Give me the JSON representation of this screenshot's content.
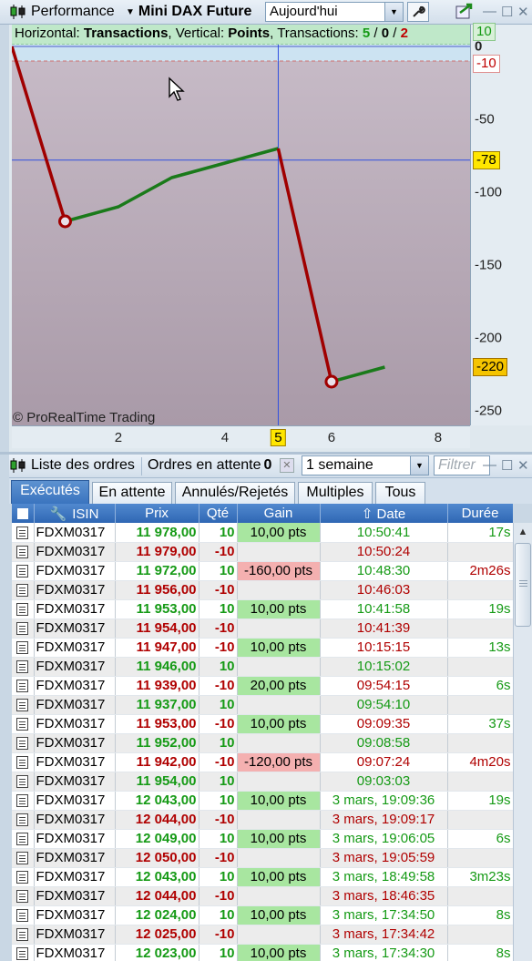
{
  "toolbar": {
    "performance_label": "Performance",
    "instrument_label": "Mini DAX Future",
    "period_value": "Aujourd'hui",
    "icons": [
      "candlestick-icon",
      "chevron-down-icon",
      "wrench-icon",
      "export-icon",
      "minimize-icon",
      "maximize-icon",
      "close-icon"
    ]
  },
  "chart": {
    "info_horizontal_label": "Horizontal:",
    "info_horizontal_value": "Transactions",
    "info_vertical_label": ", Vertical:",
    "info_vertical_value": "Points",
    "info_transactions_label": ", Transactions:",
    "info_wins": "5",
    "info_sep1": " / ",
    "info_even": "0",
    "info_sep2": " / ",
    "info_losses": "2",
    "copyright": "© ProRealTime Trading",
    "tag_up": "10",
    "tag_down": "-10",
    "tag_crosshair": "-78",
    "tag_last": "-220",
    "tag_x": "5",
    "zero_label": "0",
    "colors": {
      "gain": "#1a7a1a",
      "loss": "#a00000",
      "crosshair": "#3050e0",
      "tag_yellow": "#ffe600"
    }
  },
  "chart_data": {
    "type": "line",
    "xlabel": "",
    "ylabel": "",
    "x": [
      0,
      1,
      2,
      3,
      4,
      5,
      6,
      7
    ],
    "y": [
      0,
      -120,
      -110,
      -90,
      -80,
      -70,
      -230,
      -220
    ],
    "segments": [
      {
        "from": 0,
        "to": 1,
        "result": "loss"
      },
      {
        "from": 1,
        "to": 5,
        "result": "gain"
      },
      {
        "from": 5,
        "to": 6,
        "result": "loss"
      },
      {
        "from": 6,
        "to": 7,
        "result": "gain"
      }
    ],
    "loss_markers_x": [
      1,
      6
    ],
    "xticks": [
      2,
      4,
      6,
      8
    ],
    "yticks": [
      -50,
      -100,
      -150,
      -200,
      -250
    ],
    "xlim": [
      0,
      8.6
    ],
    "ylim": [
      -260,
      15
    ],
    "crosshair": {
      "x": 5,
      "y": -78
    },
    "band_lines": [
      10,
      -10
    ]
  },
  "orders": {
    "title": "Liste des ordres",
    "pending_label": "Ordres en attente",
    "pending_count": "0",
    "period_value": "1 semaine",
    "filter_placeholder": "Filtrer",
    "tabs": [
      "Exécutés",
      "En attente",
      "Annulés/Rejetés",
      "Multiples",
      "Tous"
    ],
    "columns": [
      "ISIN",
      "Prix",
      "Qté",
      "Gain",
      "Date",
      "Durée"
    ],
    "rows": [
      {
        "isin": "FDXM0317",
        "prix": "11 978,00",
        "qte": "10",
        "gain": "10,00 pts",
        "date": "10:50:41",
        "duree": "17s"
      },
      {
        "isin": "FDXM0317",
        "prix": "11 979,00",
        "qte": "-10",
        "gain": "",
        "date": "10:50:24",
        "duree": ""
      },
      {
        "isin": "FDXM0317",
        "prix": "11 972,00",
        "qte": "10",
        "gain": "-160,00 pts",
        "date": "10:48:30",
        "duree": "2m26s"
      },
      {
        "isin": "FDXM0317",
        "prix": "11 956,00",
        "qte": "-10",
        "gain": "",
        "date": "10:46:03",
        "duree": ""
      },
      {
        "isin": "FDXM0317",
        "prix": "11 953,00",
        "qte": "10",
        "gain": "10,00 pts",
        "date": "10:41:58",
        "duree": "19s"
      },
      {
        "isin": "FDXM0317",
        "prix": "11 954,00",
        "qte": "-10",
        "gain": "",
        "date": "10:41:39",
        "duree": ""
      },
      {
        "isin": "FDXM0317",
        "prix": "11 947,00",
        "qte": "-10",
        "gain": "10,00 pts",
        "date": "10:15:15",
        "duree": "13s"
      },
      {
        "isin": "FDXM0317",
        "prix": "11 946,00",
        "qte": "10",
        "gain": "",
        "date": "10:15:02",
        "duree": ""
      },
      {
        "isin": "FDXM0317",
        "prix": "11 939,00",
        "qte": "-10",
        "gain": "20,00 pts",
        "date": "09:54:15",
        "duree": "6s"
      },
      {
        "isin": "FDXM0317",
        "prix": "11 937,00",
        "qte": "10",
        "gain": "",
        "date": "09:54:10",
        "duree": ""
      },
      {
        "isin": "FDXM0317",
        "prix": "11 953,00",
        "qte": "-10",
        "gain": "10,00 pts",
        "date": "09:09:35",
        "duree": "37s"
      },
      {
        "isin": "FDXM0317",
        "prix": "11 952,00",
        "qte": "10",
        "gain": "",
        "date": "09:08:58",
        "duree": ""
      },
      {
        "isin": "FDXM0317",
        "prix": "11 942,00",
        "qte": "-10",
        "gain": "-120,00 pts",
        "date": "09:07:24",
        "duree": "4m20s"
      },
      {
        "isin": "FDXM0317",
        "prix": "11 954,00",
        "qte": "10",
        "gain": "",
        "date": "09:03:03",
        "duree": ""
      },
      {
        "isin": "FDXM0317",
        "prix": "12 043,00",
        "qte": "10",
        "gain": "10,00 pts",
        "date": "3 mars, 19:09:36",
        "duree": "19s"
      },
      {
        "isin": "FDXM0317",
        "prix": "12 044,00",
        "qte": "-10",
        "gain": "",
        "date": "3 mars, 19:09:17",
        "duree": ""
      },
      {
        "isin": "FDXM0317",
        "prix": "12 049,00",
        "qte": "10",
        "gain": "10,00 pts",
        "date": "3 mars, 19:06:05",
        "duree": "6s"
      },
      {
        "isin": "FDXM0317",
        "prix": "12 050,00",
        "qte": "-10",
        "gain": "",
        "date": "3 mars, 19:05:59",
        "duree": ""
      },
      {
        "isin": "FDXM0317",
        "prix": "12 043,00",
        "qte": "10",
        "gain": "10,00 pts",
        "date": "3 mars, 18:49:58",
        "duree": "3m23s"
      },
      {
        "isin": "FDXM0317",
        "prix": "12 044,00",
        "qte": "-10",
        "gain": "",
        "date": "3 mars, 18:46:35",
        "duree": ""
      },
      {
        "isin": "FDXM0317",
        "prix": "12 024,00",
        "qte": "10",
        "gain": "10,00 pts",
        "date": "3 mars, 17:34:50",
        "duree": "8s"
      },
      {
        "isin": "FDXM0317",
        "prix": "12 025,00",
        "qte": "-10",
        "gain": "",
        "date": "3 mars, 17:34:42",
        "duree": ""
      },
      {
        "isin": "FDXM0317",
        "prix": "12 023,00",
        "qte": "10",
        "gain": "10,00 pts",
        "date": "3 mars, 17:34:30",
        "duree": "8s"
      }
    ]
  }
}
